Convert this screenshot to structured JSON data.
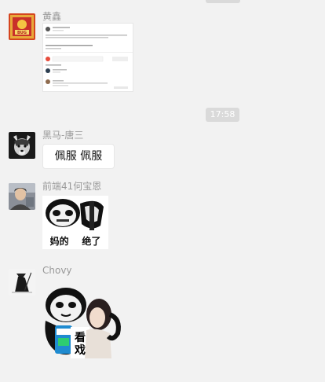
{
  "messages": [
    {
      "sender": "黄鑫",
      "type": "image",
      "image_description_icon": "screenshot-thumbnail",
      "thumbnail_text": {
        "line1": "5月8日",
        "line2": "Q: 1.0.7 javascript 报错",
        "line3": "全部评论",
        "line4": "回复"
      }
    },
    {
      "type": "time",
      "time": "17:58"
    },
    {
      "sender": "黑马-唐三",
      "type": "text",
      "text": "佩服  佩服"
    },
    {
      "sender": "前端41何宝恩",
      "type": "sticker",
      "caption": "妈的    绝了"
    },
    {
      "sender": "Chovy",
      "type": "sticker",
      "caption": "看戏"
    }
  ],
  "avatar_icons": {
    "huangxin": "bug-poster-avatar",
    "tangsan": "husky-avatar",
    "hebaoen": "person-photo-avatar",
    "chovy": "swordsman-avatar"
  }
}
